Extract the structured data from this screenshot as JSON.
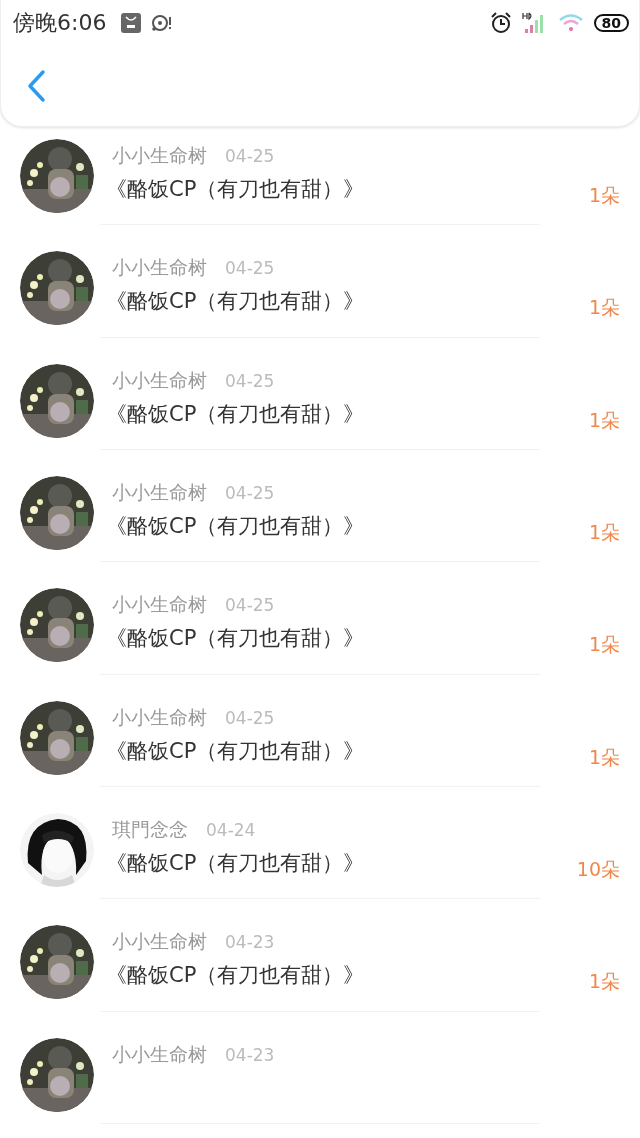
{
  "status_bar": {
    "time": "傍晚6:06",
    "battery": "80"
  },
  "rows": [
    {
      "name": "小小生命树",
      "date": "04-25",
      "title": "《酪饭CP（有刀也有甜）》",
      "amount": "1朵"
    },
    {
      "name": "小小生命树",
      "date": "04-25",
      "title": "《酪饭CP（有刀也有甜）》",
      "amount": "1朵"
    },
    {
      "name": "小小生命树",
      "date": "04-25",
      "title": "《酪饭CP（有刀也有甜）》",
      "amount": "1朵"
    },
    {
      "name": "小小生命树",
      "date": "04-25",
      "title": "《酪饭CP（有刀也有甜）》",
      "amount": "1朵"
    },
    {
      "name": "小小生命树",
      "date": "04-25",
      "title": "《酪饭CP（有刀也有甜）》",
      "amount": "1朵"
    },
    {
      "name": "小小生命树",
      "date": "04-25",
      "title": "《酪饭CP（有刀也有甜）》",
      "amount": "1朵"
    },
    {
      "name": "琪門念念",
      "date": "04-24",
      "title": "《酪饭CP（有刀也有甜）》",
      "amount": "10朵"
    },
    {
      "name": "小小生命树",
      "date": "04-23",
      "title": "《酪饭CP（有刀也有甜）》",
      "amount": "1朵"
    },
    {
      "name": "小小生命树",
      "date": "04-23"
    }
  ]
}
